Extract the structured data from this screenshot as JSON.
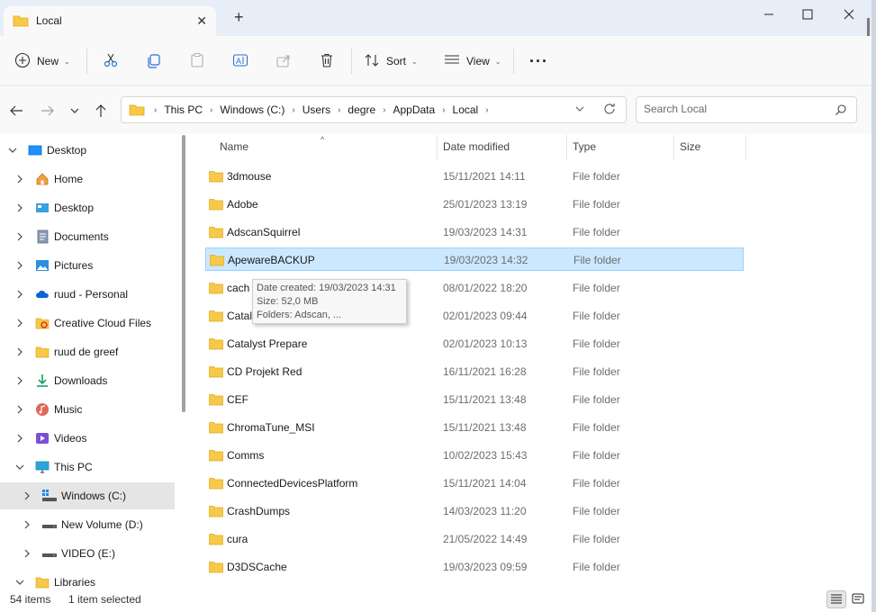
{
  "window": {
    "tab_title": "Local",
    "new_tab": "+",
    "minimize": "–",
    "maximize": "□",
    "close": "✕"
  },
  "toolbar": {
    "new_label": "New",
    "sort_label": "Sort",
    "view_label": "View",
    "more": "···"
  },
  "breadcrumb": [
    "This PC",
    "Windows (C:)",
    "Users",
    "degre",
    "AppData",
    "Local"
  ],
  "search": {
    "placeholder": "Search Local"
  },
  "sidebar": {
    "items": [
      {
        "label": "Desktop",
        "icon": "desktop-icon"
      },
      {
        "label": "Home",
        "icon": "home-icon"
      },
      {
        "label": "Desktop",
        "icon": "desktop-icon"
      },
      {
        "label": "Documents",
        "icon": "documents-icon"
      },
      {
        "label": "Pictures",
        "icon": "pictures-icon"
      },
      {
        "label": "ruud - Personal",
        "icon": "onedrive-icon"
      },
      {
        "label": "Creative Cloud Files",
        "icon": "creative-cloud-icon"
      },
      {
        "label": "ruud de greef",
        "icon": "folder-icon"
      },
      {
        "label": "Downloads",
        "icon": "downloads-icon"
      },
      {
        "label": "Music",
        "icon": "music-icon"
      },
      {
        "label": "Videos",
        "icon": "videos-icon"
      },
      {
        "label": "This PC",
        "icon": "computer-icon"
      },
      {
        "label": "Windows (C:)",
        "icon": "windows-drive-icon"
      },
      {
        "label": "New Volume (D:)",
        "icon": "drive-icon"
      },
      {
        "label": "VIDEO (E:)",
        "icon": "drive-icon"
      },
      {
        "label": "Libraries",
        "icon": "folder-icon"
      }
    ]
  },
  "columns": {
    "name": "Name",
    "date": "Date modified",
    "type": "Type",
    "size": "Size"
  },
  "files": [
    {
      "name": "3dmouse",
      "date": "15/11/2021 14:11",
      "type": "File folder"
    },
    {
      "name": "Adobe",
      "date": "25/01/2023 13:19",
      "type": "File folder"
    },
    {
      "name": "AdscanSquirrel",
      "date": "19/03/2023 14:31",
      "type": "File folder"
    },
    {
      "name": "ApewareBACKUP",
      "date": "19/03/2023 14:32",
      "type": "File folder"
    },
    {
      "name": "cach",
      "date": "08/01/2022 18:20",
      "type": "File folder"
    },
    {
      "name": "Catal",
      "date": "02/01/2023 09:44",
      "type": "File folder"
    },
    {
      "name": "Catalyst Prepare",
      "date": "02/01/2023 10:13",
      "type": "File folder"
    },
    {
      "name": "CD Projekt Red",
      "date": "16/11/2021 16:28",
      "type": "File folder"
    },
    {
      "name": "CEF",
      "date": "15/11/2021 13:48",
      "type": "File folder"
    },
    {
      "name": "ChromaTune_MSI",
      "date": "15/11/2021 13:48",
      "type": "File folder"
    },
    {
      "name": "Comms",
      "date": "10/02/2023 15:43",
      "type": "File folder"
    },
    {
      "name": "ConnectedDevicesPlatform",
      "date": "15/11/2021 14:04",
      "type": "File folder"
    },
    {
      "name": "CrashDumps",
      "date": "14/03/2023 11:20",
      "type": "File folder"
    },
    {
      "name": "cura",
      "date": "21/05/2022 14:49",
      "type": "File folder"
    },
    {
      "name": "D3DSCache",
      "date": "19/03/2023 09:59",
      "type": "File folder"
    }
  ],
  "tooltip": {
    "created": "Date created: 19/03/2023 14:31",
    "size": "Size: 52,0 MB",
    "folders": "Folders: Adscan, ..."
  },
  "status": {
    "count": "54 items",
    "selected": "1 item selected"
  },
  "colors": {
    "selection": "#cce8ff",
    "folder": "#f7c948",
    "accent": "#0067c0"
  }
}
